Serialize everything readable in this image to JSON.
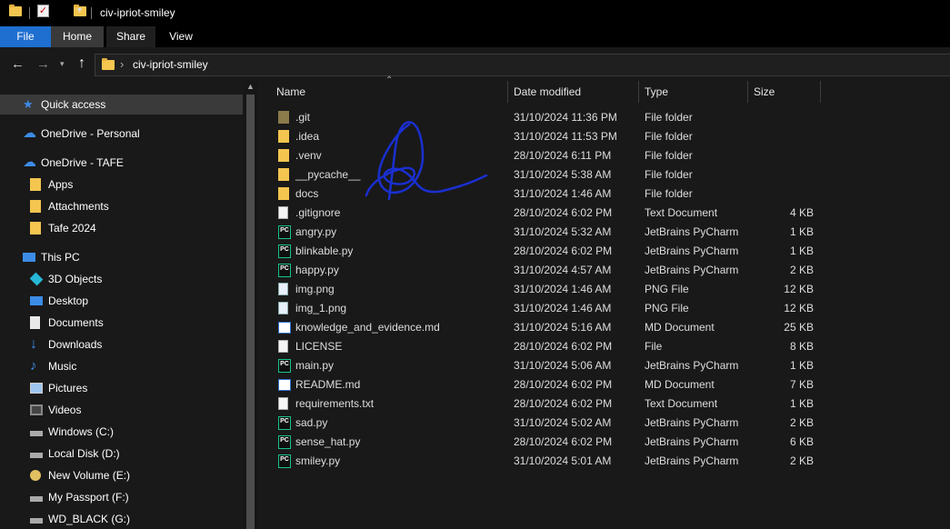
{
  "window": {
    "title": "civ-ipriot-smiley"
  },
  "ribbon": {
    "tabs": [
      "File",
      "Home",
      "Share",
      "View"
    ]
  },
  "address": {
    "path": "civ-ipriot-smiley",
    "chevron": "›"
  },
  "nav": {
    "items": [
      {
        "label": "Quick access",
        "icon": "star-icon"
      },
      {
        "label": "OneDrive - Personal",
        "icon": "cloud-icon"
      },
      {
        "label": "OneDrive - TAFE",
        "icon": "cloud-icon"
      },
      {
        "label": "Apps",
        "icon": "folder-icon"
      },
      {
        "label": "Attachments",
        "icon": "folder-icon"
      },
      {
        "label": "Tafe 2024",
        "icon": "folder-icon"
      },
      {
        "label": "This PC",
        "icon": "pc-icon"
      },
      {
        "label": "3D Objects",
        "icon": "cube-icon"
      },
      {
        "label": "Desktop",
        "icon": "desktop-icon"
      },
      {
        "label": "Documents",
        "icon": "document-icon"
      },
      {
        "label": "Downloads",
        "icon": "download-icon"
      },
      {
        "label": "Music",
        "icon": "music-icon"
      },
      {
        "label": "Pictures",
        "icon": "pictures-icon"
      },
      {
        "label": "Videos",
        "icon": "video-icon"
      },
      {
        "label": "Windows (C:)",
        "icon": "drive-icon"
      },
      {
        "label": "Local Disk (D:)",
        "icon": "drive-icon"
      },
      {
        "label": "New Volume (E:)",
        "icon": "disc-icon"
      },
      {
        "label": "My Passport (F:)",
        "icon": "drive-icon"
      },
      {
        "label": "WD_BLACK (G:)",
        "icon": "drive-icon"
      }
    ]
  },
  "columns": {
    "name": "Name",
    "date": "Date modified",
    "type": "Type",
    "size": "Size"
  },
  "files": [
    {
      "name": ".git",
      "date": "31/10/2024 11:36 PM",
      "type": "File folder",
      "size": "",
      "icon": "git-folder-icon"
    },
    {
      "name": ".idea",
      "date": "31/10/2024 11:53 PM",
      "type": "File folder",
      "size": "",
      "icon": "folder-icon"
    },
    {
      "name": ".venv",
      "date": "28/10/2024 6:11 PM",
      "type": "File folder",
      "size": "",
      "icon": "folder-icon"
    },
    {
      "name": "__pycache__",
      "date": "31/10/2024 5:38 AM",
      "type": "File folder",
      "size": "",
      "icon": "folder-icon"
    },
    {
      "name": "docs",
      "date": "31/10/2024 1:46 AM",
      "type": "File folder",
      "size": "",
      "icon": "folder-icon"
    },
    {
      "name": ".gitignore",
      "date": "28/10/2024 6:02 PM",
      "type": "Text Document",
      "size": "4 KB",
      "icon": "text-file-icon"
    },
    {
      "name": "angry.py",
      "date": "31/10/2024 5:32 AM",
      "type": "JetBrains PyCharm",
      "size": "1 KB",
      "icon": "pycharm-file-icon"
    },
    {
      "name": "blinkable.py",
      "date": "28/10/2024 6:02 PM",
      "type": "JetBrains PyCharm",
      "size": "1 KB",
      "icon": "pycharm-file-icon"
    },
    {
      "name": "happy.py",
      "date": "31/10/2024 4:57 AM",
      "type": "JetBrains PyCharm",
      "size": "2 KB",
      "icon": "pycharm-file-icon"
    },
    {
      "name": "img.png",
      "date": "31/10/2024 1:46 AM",
      "type": "PNG File",
      "size": "12 KB",
      "icon": "image-file-icon"
    },
    {
      "name": "img_1.png",
      "date": "31/10/2024 1:46 AM",
      "type": "PNG File",
      "size": "12 KB",
      "icon": "image-file-icon"
    },
    {
      "name": "knowledge_and_evidence.md",
      "date": "31/10/2024 5:16 AM",
      "type": "MD Document",
      "size": "25 KB",
      "icon": "md-file-icon"
    },
    {
      "name": "LICENSE",
      "date": "28/10/2024 6:02 PM",
      "type": "File",
      "size": "8 KB",
      "icon": "blank-file-icon"
    },
    {
      "name": "main.py",
      "date": "31/10/2024 5:06 AM",
      "type": "JetBrains PyCharm",
      "size": "1 KB",
      "icon": "pycharm-file-icon"
    },
    {
      "name": "README.md",
      "date": "28/10/2024 6:02 PM",
      "type": "MD Document",
      "size": "7 KB",
      "icon": "md-file-icon"
    },
    {
      "name": "requirements.txt",
      "date": "28/10/2024 6:02 PM",
      "type": "Text Document",
      "size": "1 KB",
      "icon": "text-file-icon"
    },
    {
      "name": "sad.py",
      "date": "31/10/2024 5:02 AM",
      "type": "JetBrains PyCharm",
      "size": "2 KB",
      "icon": "pycharm-file-icon"
    },
    {
      "name": "sense_hat.py",
      "date": "28/10/2024 6:02 PM",
      "type": "JetBrains PyCharm",
      "size": "6 KB",
      "icon": "pycharm-file-icon"
    },
    {
      "name": "smiley.py",
      "date": "31/10/2024 5:01 AM",
      "type": "JetBrains PyCharm",
      "size": "2 KB",
      "icon": "pycharm-file-icon"
    }
  ],
  "colors": {
    "accent": "#1e6fd0",
    "folder": "#f4c54f",
    "pycharm": "#17c28e",
    "ink": "#1a2fd0"
  }
}
